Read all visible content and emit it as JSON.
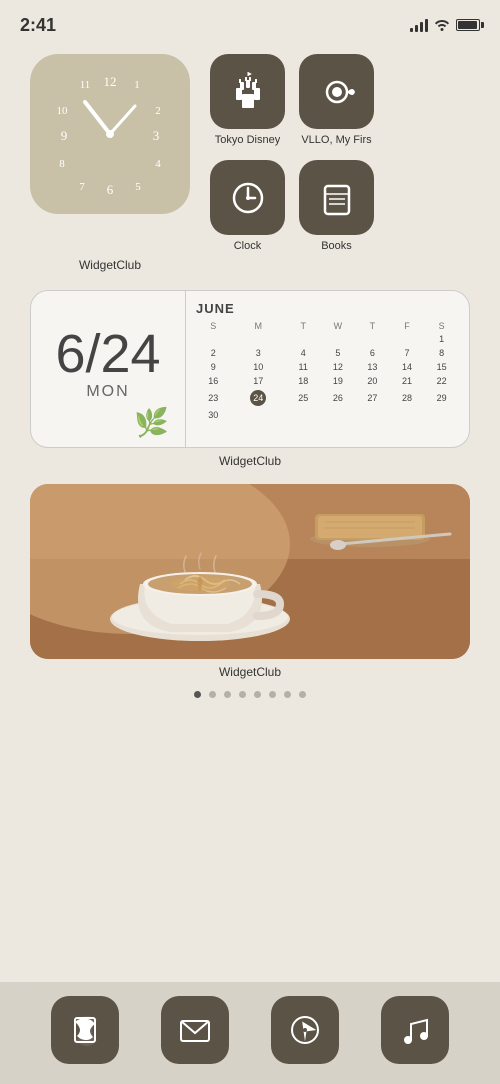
{
  "statusBar": {
    "time": "2:41"
  },
  "apps": {
    "row1": [
      {
        "name": "Tokyo Disney",
        "label": "Tokyo Disney",
        "icon": "castle"
      },
      {
        "name": "VLLO",
        "label": "VLLO, My Firs",
        "icon": "camera-movie"
      }
    ],
    "row2": [
      {
        "name": "Clock",
        "label": "Clock",
        "icon": "clock"
      },
      {
        "name": "Books",
        "label": "Books",
        "icon": "book"
      }
    ]
  },
  "clockWidget": {
    "label": "WidgetClub"
  },
  "calendarWidget": {
    "month": "JUNE",
    "date": "6/24",
    "day": "MON",
    "label": "WidgetClub",
    "weekdays": [
      "S",
      "M",
      "T",
      "W",
      "T",
      "F",
      "S"
    ],
    "weeks": [
      [
        "",
        "",
        "",
        "",
        "",
        "",
        "1"
      ],
      [
        "2",
        "3",
        "4",
        "5",
        "6",
        "7",
        "8"
      ],
      [
        "9",
        "10",
        "11",
        "12",
        "13",
        "14",
        "15"
      ],
      [
        "16",
        "17",
        "18",
        "19",
        "20",
        "21",
        "22"
      ],
      [
        "23",
        "24",
        "25",
        "26",
        "27",
        "28",
        "29"
      ],
      [
        "30",
        "",
        "",
        "",
        "",
        "",
        ""
      ]
    ],
    "today": "24"
  },
  "photoWidget": {
    "label": "WidgetClub"
  },
  "pageDots": {
    "total": 8,
    "active": 0
  },
  "dock": [
    {
      "name": "Phone",
      "icon": "phone"
    },
    {
      "name": "Mail",
      "icon": "mail"
    },
    {
      "name": "Safari",
      "icon": "compass"
    },
    {
      "name": "Music",
      "icon": "music"
    }
  ]
}
